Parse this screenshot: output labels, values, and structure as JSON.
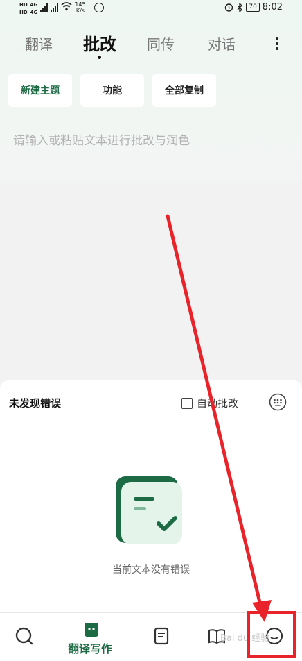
{
  "status_bar": {
    "hd1": "HD",
    "hd2": "HD",
    "net1": "4G",
    "net2": "4G",
    "speed_value": "145",
    "speed_unit": "K/s",
    "battery": "70",
    "time": "8:02"
  },
  "tabs": [
    {
      "label": "翻译"
    },
    {
      "label": "批改"
    },
    {
      "label": "同传"
    },
    {
      "label": "对话"
    }
  ],
  "active_tab": "批改",
  "actions": {
    "new_topic": "新建主题",
    "features": "功能",
    "copy_all": "全部复制"
  },
  "editor": {
    "placeholder": "请输入或粘贴文本进行批改与润色"
  },
  "panel": {
    "title": "未发现错误",
    "auto_correct_label": "自动批改",
    "empty_message": "当前文本没有错误"
  },
  "bottom_nav": {
    "active_label": "翻译写作",
    "items": [
      "search-icon",
      "translate-write-icon",
      "document-icon",
      "book-icon",
      "profile-icon"
    ]
  },
  "watermark": "Bai du 经验",
  "colors": {
    "brand_green": "#1d6b45",
    "annotation_red": "#e8232a"
  }
}
